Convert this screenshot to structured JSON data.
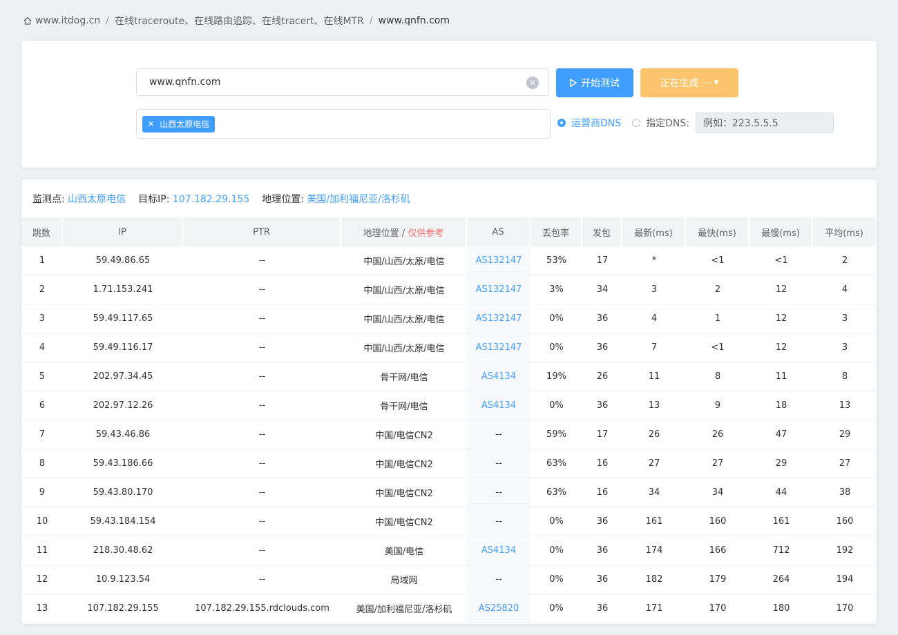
{
  "breadcrumb": {
    "home": "www.itdog.cn",
    "tool": "在线traceroute、在线路由追踪、在线tracert、在线MTR",
    "current": "www.qnfn.com"
  },
  "form": {
    "host_value": "www.qnfn.com",
    "start_button": "开始测试",
    "generating_button": "正在生成 ···",
    "node_tag": "山西太原电信",
    "radio_isp_dns": "运营商DNS",
    "radio_custom_dns": "指定DNS:",
    "dns_placeholder": "例如：223.5.5.5"
  },
  "info": {
    "monitor_label": "监测点:",
    "monitor_value": "山西太原电信",
    "target_label": "目标IP:",
    "target_value": "107.182.29.155",
    "location_label": "地理位置:",
    "location_value": "美国/加利福尼亚/洛杉矶"
  },
  "table": {
    "headers": {
      "hop": "跳数",
      "ip": "IP",
      "ptr": "PTR",
      "geo": "地理位置 / ",
      "geo_ref": "仅供参考",
      "as": "AS",
      "loss": "丢包率",
      "sent": "发包",
      "last": "最新(ms)",
      "best": "最快(ms)",
      "worst": "最慢(ms)",
      "avg": "平均(ms)"
    },
    "rows": [
      {
        "hop": "1",
        "ip": "59.49.86.65",
        "ptr": "--",
        "geo": "中国/山西/太原/电信",
        "as": "AS132147",
        "loss": "53%",
        "sent": "17",
        "last": "*",
        "best": "<1",
        "worst": "<1",
        "avg": "2"
      },
      {
        "hop": "2",
        "ip": "1.71.153.241",
        "ptr": "--",
        "geo": "中国/山西/太原/电信",
        "as": "AS132147",
        "loss": "3%",
        "sent": "34",
        "last": "3",
        "best": "2",
        "worst": "12",
        "avg": "4"
      },
      {
        "hop": "3",
        "ip": "59.49.117.65",
        "ptr": "--",
        "geo": "中国/山西/太原/电信",
        "as": "AS132147",
        "loss": "0%",
        "sent": "36",
        "last": "4",
        "best": "1",
        "worst": "12",
        "avg": "3"
      },
      {
        "hop": "4",
        "ip": "59.49.116.17",
        "ptr": "--",
        "geo": "中国/山西/太原/电信",
        "as": "AS132147",
        "loss": "0%",
        "sent": "36",
        "last": "7",
        "best": "<1",
        "worst": "12",
        "avg": "3"
      },
      {
        "hop": "5",
        "ip": "202.97.34.45",
        "ptr": "--",
        "geo": "骨干网/电信",
        "as": "AS4134",
        "loss": "19%",
        "sent": "26",
        "last": "11",
        "best": "8",
        "worst": "11",
        "avg": "8"
      },
      {
        "hop": "6",
        "ip": "202.97.12.26",
        "ptr": "--",
        "geo": "骨干网/电信",
        "as": "AS4134",
        "loss": "0%",
        "sent": "36",
        "last": "13",
        "best": "9",
        "worst": "18",
        "avg": "13"
      },
      {
        "hop": "7",
        "ip": "59.43.46.86",
        "ptr": "--",
        "geo": "中国/电信CN2",
        "as": "--",
        "loss": "59%",
        "sent": "17",
        "last": "26",
        "best": "26",
        "worst": "47",
        "avg": "29"
      },
      {
        "hop": "8",
        "ip": "59.43.186.66",
        "ptr": "--",
        "geo": "中国/电信CN2",
        "as": "--",
        "loss": "63%",
        "sent": "16",
        "last": "27",
        "best": "27",
        "worst": "29",
        "avg": "27"
      },
      {
        "hop": "9",
        "ip": "59.43.80.170",
        "ptr": "--",
        "geo": "中国/电信CN2",
        "as": "--",
        "loss": "63%",
        "sent": "16",
        "last": "34",
        "best": "34",
        "worst": "44",
        "avg": "38"
      },
      {
        "hop": "10",
        "ip": "59.43.184.154",
        "ptr": "--",
        "geo": "中国/电信CN2",
        "as": "--",
        "loss": "0%",
        "sent": "36",
        "last": "161",
        "best": "160",
        "worst": "161",
        "avg": "160"
      },
      {
        "hop": "11",
        "ip": "218.30.48.62",
        "ptr": "--",
        "geo": "美国/电信",
        "as": "AS4134",
        "loss": "0%",
        "sent": "36",
        "last": "174",
        "best": "166",
        "worst": "712",
        "avg": "192"
      },
      {
        "hop": "12",
        "ip": "10.9.123.54",
        "ptr": "--",
        "geo": "局域网",
        "as": "--",
        "loss": "0%",
        "sent": "36",
        "last": "182",
        "best": "179",
        "worst": "264",
        "avg": "194"
      },
      {
        "hop": "13",
        "ip": "107.182.29.155",
        "ptr": "107.182.29.155.rdclouds.com",
        "geo": "美国/加利福尼亚/洛杉矶",
        "as": "AS25820",
        "loss": "0%",
        "sent": "36",
        "last": "171",
        "best": "170",
        "worst": "180",
        "avg": "170"
      }
    ]
  },
  "colors": {
    "primary": "#409eff",
    "warning": "#fcc46c",
    "danger": "#f56c6c"
  }
}
